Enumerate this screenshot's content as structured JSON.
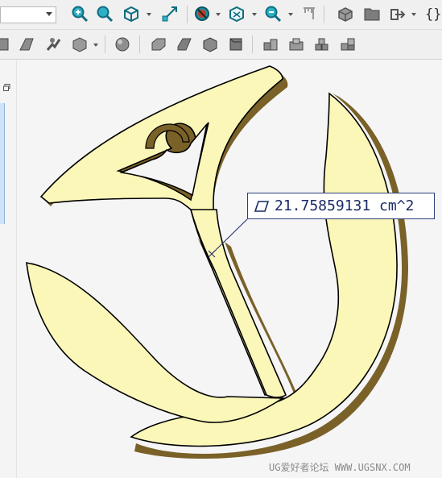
{
  "measurement": {
    "value_text": "21.75859131 cm^2",
    "icon": "area-parallelogram-icon"
  },
  "watermark": {
    "text": "UG爱好者论坛 WWW.UGSNX.COM"
  },
  "toolbar": {
    "row1_icons": [
      "zoom-fit-icon",
      "zoom-icon",
      "view-orient-icon",
      "snap-view-icon",
      "render-style-icon",
      "wireframe-icon",
      "zoom-window-icon",
      "measure-icon",
      "part-icon",
      "folder-icon",
      "export-icon"
    ],
    "row2_icons": [
      "shape-icon",
      "blend-icon",
      "move-icon",
      "cube-icon",
      "sphere-icon",
      "block-icon",
      "shaded-block-icon",
      "box-icon",
      "cube-dark-icon",
      "assembly-icon",
      "assembly-2-icon",
      "assembly-3-icon",
      "assembly-4-icon"
    ],
    "braces_label": "{}"
  },
  "colors": {
    "part_face": "#fbf7b8",
    "part_side": "#7a6128",
    "callout_border": "#2a3e7a",
    "toolbar_accent": "#1e8fa0"
  }
}
